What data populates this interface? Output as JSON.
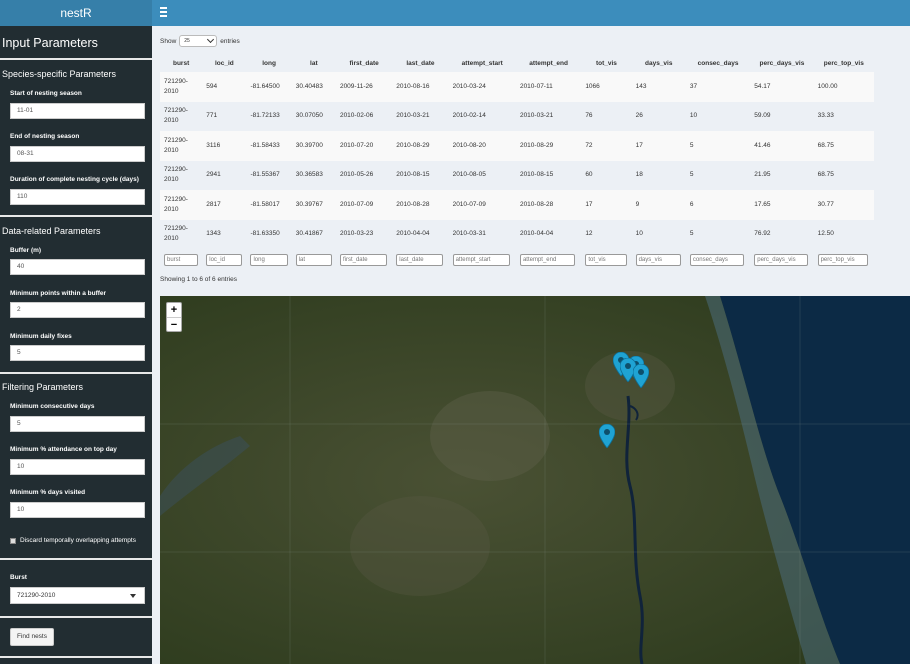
{
  "app": {
    "title": "nestR"
  },
  "sidebar": {
    "heading": "Input Parameters",
    "species_section": "Species-specific Parameters",
    "start_label": "Start of nesting season",
    "start_value": "11-01",
    "end_label": "End of nesting season",
    "end_value": "08-31",
    "duration_label": "Duration of complete nesting cycle (days)",
    "duration_value": "110",
    "data_section": "Data-related Parameters",
    "buffer_label": "Buffer (m)",
    "buffer_value": "40",
    "min_points_label": "Minimum points within a buffer",
    "min_points_value": "2",
    "min_fixes_label": "Minimum daily fixes",
    "min_fixes_value": "5",
    "filter_section": "Filtering Parameters",
    "min_consec_label": "Minimum consecutive days",
    "min_consec_value": "5",
    "min_attendance_label": "Minimum % attendance on top day",
    "min_attendance_value": "10",
    "min_visited_label": "Minimum % days visited",
    "min_visited_value": "10",
    "discard_label": "Discard temporally overlapping attempts",
    "burst_label": "Burst",
    "burst_value": "721290-2010",
    "find_button": "Find nests"
  },
  "table": {
    "show_label": "Show",
    "length_value": "25",
    "entries_label": "entries",
    "columns": [
      "burst",
      "loc_id",
      "long",
      "lat",
      "first_date",
      "last_date",
      "attempt_start",
      "attempt_end",
      "tot_vis",
      "days_vis",
      "consec_days",
      "perc_days_vis",
      "perc_top_vis"
    ],
    "rows": [
      [
        "721290-2010",
        "594",
        "-81.64500",
        "30.40483",
        "2009-11-26",
        "2010-08-16",
        "2010-03-24",
        "2010-07-11",
        "1066",
        "143",
        "37",
        "54.17",
        "100.00"
      ],
      [
        "721290-2010",
        "771",
        "-81.72133",
        "30.07050",
        "2010-02-06",
        "2010-03-21",
        "2010-02-14",
        "2010-03-21",
        "76",
        "26",
        "10",
        "59.09",
        "33.33"
      ],
      [
        "721290-2010",
        "3116",
        "-81.58433",
        "30.39700",
        "2010-07-20",
        "2010-08-29",
        "2010-08-20",
        "2010-08-29",
        "72",
        "17",
        "5",
        "41.46",
        "68.75"
      ],
      [
        "721290-2010",
        "2941",
        "-81.55367",
        "30.36583",
        "2010-05-26",
        "2010-08-15",
        "2010-08-05",
        "2010-08-15",
        "60",
        "18",
        "5",
        "21.95",
        "68.75"
      ],
      [
        "721290-2010",
        "2817",
        "-81.58017",
        "30.39767",
        "2010-07-09",
        "2010-08-28",
        "2010-07-09",
        "2010-08-28",
        "17",
        "9",
        "6",
        "17.65",
        "30.77"
      ],
      [
        "721290-2010",
        "1343",
        "-81.63350",
        "30.41867",
        "2010-03-23",
        "2010-04-04",
        "2010-03-31",
        "2010-04-04",
        "12",
        "10",
        "5",
        "76.92",
        "12.50"
      ]
    ],
    "info": "Showing 1 to 6 of 6 entries"
  },
  "map": {
    "zoom_in": "+",
    "zoom_out": "−",
    "marker_color": "#1fa3d3"
  }
}
